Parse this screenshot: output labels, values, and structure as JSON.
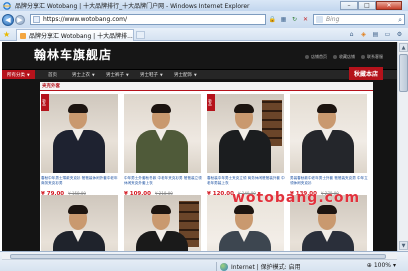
{
  "window": {
    "title": "品牌分享汇 Wotobang | 十大品牌排行_十大品牌门户网 - Windows Internet Explorer",
    "minimize": "–",
    "maximize": "□",
    "close": "✕"
  },
  "address_bar": {
    "url": "https://www.wotobang.com/",
    "search_placeholder": "Bing"
  },
  "tab": {
    "label": "品牌分享汇 Wotobang | 十大品牌排..."
  },
  "store": {
    "title": "翰林车旗舰店",
    "links": [
      "店铺首页",
      "收藏店铺",
      "联系客服"
    ],
    "nav": {
      "all_categories": "所有分类",
      "items": [
        "首页",
        "男士上衣",
        "男士裤子",
        "男士鞋子",
        "男士配饰"
      ],
      "right_banner": "秋藏本店"
    },
    "category_header": "夹克外套"
  },
  "products": [
    {
      "badge": "新品",
      "desc": "春秋中年男士薄款夹克衫 爸爸装休闲外套中老年 商务夹克衫男",
      "price": "¥ 79.00",
      "old_price": "¥ 158.00"
    },
    {
      "badge": "",
      "desc": "中年男士外套秋冬款 中老年夹克衫男 爸爸装立领休闲夹克外套上衣",
      "price": "¥ 109.00",
      "old_price": "¥ 218.00"
    },
    {
      "badge": "新品",
      "desc": "春秋装中年男士夹克立领 商务休闲爸爸装外套 中老年男装上衣",
      "price": "¥ 120.00",
      "old_price": "¥ 240.00"
    },
    {
      "badge": "",
      "desc": "男装春秋款中老年男士外套 爸爸装夹克男 中年立领休闲夹克衫",
      "price": "¥ 139.00",
      "old_price": "¥ 278.00"
    }
  ],
  "watermark": "wotobang.com",
  "status_bar": {
    "zone": "Internet | 保护模式: 启用",
    "zoom": "100%"
  },
  "colors": {
    "store_red": "#b5121b",
    "price_red": "#d3161f",
    "link_blue": "#1a4fa0"
  }
}
